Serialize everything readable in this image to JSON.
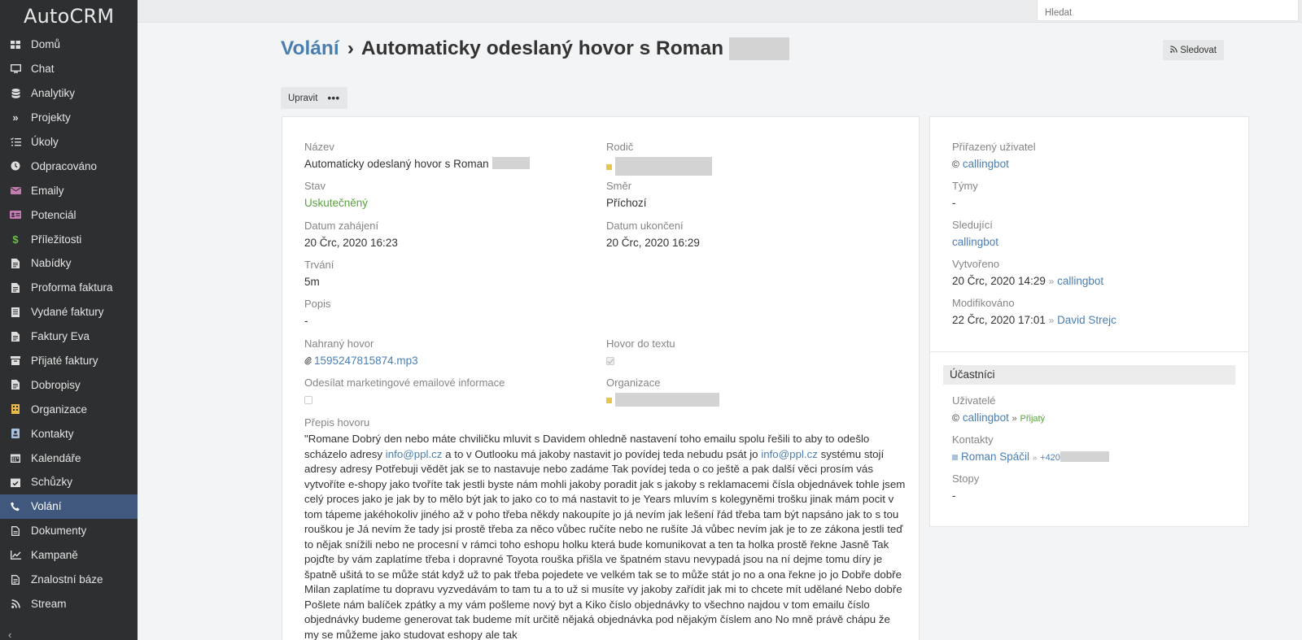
{
  "app": {
    "logo": "AutoCRM"
  },
  "search": {
    "placeholder": "Hledat"
  },
  "sidebar": {
    "items": [
      {
        "label": "Domů",
        "icon": "dashboard-icon"
      },
      {
        "label": "Chat",
        "icon": "monitor-icon"
      },
      {
        "label": "Analytiky",
        "icon": "database-icon"
      },
      {
        "label": "Projekty",
        "icon": "double-chevron-icon"
      },
      {
        "label": "Úkoly",
        "icon": "task-list-icon"
      },
      {
        "label": "Odpracováno",
        "icon": "clock-icon"
      },
      {
        "label": "Emaily",
        "icon": "envelope-icon"
      },
      {
        "label": "Potenciál",
        "icon": "id-card-icon"
      },
      {
        "label": "Příležitosti",
        "icon": "dollar-icon"
      },
      {
        "label": "Nabídky",
        "icon": "document-icon"
      },
      {
        "label": "Proforma faktura",
        "icon": "document-icon"
      },
      {
        "label": "Vydané faktury",
        "icon": "invoice-icon"
      },
      {
        "label": "Faktury Eva",
        "icon": "document-icon"
      },
      {
        "label": "Přijaté faktury",
        "icon": "archive-icon"
      },
      {
        "label": "Dobropisy",
        "icon": "document-icon"
      },
      {
        "label": "Organizace",
        "icon": "building-icon"
      },
      {
        "label": "Kontakty",
        "icon": "contact-card-icon"
      },
      {
        "label": "Kalendáře",
        "icon": "calendar-icon"
      },
      {
        "label": "Schůzky",
        "icon": "calendar-check-icon"
      },
      {
        "label": "Volání",
        "icon": "phone-icon",
        "active": true
      },
      {
        "label": "Dokumenty",
        "icon": "file-icon"
      },
      {
        "label": "Kampaně",
        "icon": "chart-line-icon"
      },
      {
        "label": "Znalostní báze",
        "icon": "book-icon"
      },
      {
        "label": "Stream",
        "icon": "rss-icon"
      }
    ],
    "collapse_glyph": "‹"
  },
  "header": {
    "breadcrumb": "Volání",
    "separator": "›",
    "title": "Automaticky odeslaný hovor s Roman",
    "follow_label": "Sledovat"
  },
  "actions": {
    "edit_label": "Upravit",
    "more_label": "•••"
  },
  "record": {
    "name_label": "Název",
    "name_value": "Automaticky odeslaný hovor s Roman",
    "parent_label": "Rodič",
    "status_label": "Stav",
    "status_value": "Uskutečněný",
    "direction_label": "Směr",
    "direction_value": "Příchozí",
    "start_label": "Datum zahájení",
    "start_value": "20 Črc, 2020 16:23",
    "end_label": "Datum ukončení",
    "end_value": "20 Črc, 2020 16:29",
    "duration_label": "Trvání",
    "duration_value": "5m",
    "description_label": "Popis",
    "description_value": "-",
    "recording_label": "Nahraný hovor",
    "recording_value": "1595247815874.mp3",
    "to_text_label": "Hovor do textu",
    "marketing_label": "Odesílat marketingové emailové informace",
    "organization_label": "Organizace",
    "transcript_label": "Přepis hovoru",
    "transcript_parts": [
      "\"Romane Dobrý den nebo máte chviličku mluvit s Davidem ohledně nastavení toho emailu spolu řešili to aby to odešlo scházelo adresy ",
      "info@ppl.cz",
      " a to v Outlooku má jakoby nastavit jo povídej teda nebudu psát jo ",
      "info@ppl.cz",
      " systému stojí adresy adresy Potřebuji vědět jak se to nastavuje nebo zadáme Tak povídej teda o co ještě a pak další věci prosím vás vytvoříte e-shopy jako tvoříte tak jestli byste nám mohli jakoby poradit jak s jakoby s reklamacemi čísla objednávek tohle jsem celý proces jako je jak by to mělo být jak to jako co to má nastavit to je Years mluvím s kolegyněmi trošku jinak mám pocit v tom tápeme jakéhokoliv jiného až v poho třeba někdy nakoupíte jo já nevím jak lešení řád třeba tam být napsáno jak to s tou rouškou je Já nevím že tady jsi prostě třeba za něco vůbec ručíte nebo ne rušíte Já vůbec nevím jak je to ze zákona jestli teď to nějak snížili nebo ne procesní v rámci toho eshopu holku která bude komunikovat a ten ta holka prostě řekne Jasně Tak pojďte by vám zaplatíme třeba i dopravné Toyota rouška přišla ve špatném stavu nevypadá jsou na ní dejme tomu díry je špatně ušitá to se může stát když už to pak třeba pojedete ve velkém tak se to může stát jo no a ona řekne jo jo Dobře dobře Milan zaplatíme tu dopravu vyzvedávám to tam tu a to už si musíte vy jakoby zařídit jak mi to chcete mít udělané Nebo dobře Pošlete nám balíček zpátky a my vám pošleme nový byt a Kiko číslo objednávky to všechno najdou v tom emailu číslo objednávky budeme generovat tak budeme mít určitě nějaká objednávka pod nějakým číslem ano No mně právě chápu že my se můžeme jako studovat eshopy ale tak"
    ]
  },
  "side": {
    "assigned_label": "Přiřazený uživatel",
    "assigned_value": "callingbot",
    "teams_label": "Týmy",
    "teams_value": "-",
    "followers_label": "Sledující",
    "followers_value": "callingbot",
    "created_label": "Vytvořeno",
    "created_date": "20 Črc, 2020 14:29",
    "created_by": "callingbot",
    "modified_label": "Modifikováno",
    "modified_date": "22 Črc, 2020 17:01",
    "modified_by": "David Strejc",
    "arrow": "»",
    "participants_title": "Účastníci",
    "users_label": "Uživatelé",
    "users_value": "callingbot",
    "users_status": "Přijatý",
    "contacts_label": "Kontakty",
    "contacts_value": "Roman Spáčil",
    "contacts_phone": "+420",
    "leads_label": "Stopy",
    "leads_value": "-"
  },
  "colors": {
    "sidebar_bg": "#2d2f31",
    "active_item": "#40577e",
    "link": "#4a7eb0",
    "status_green": "#5aa13f"
  }
}
